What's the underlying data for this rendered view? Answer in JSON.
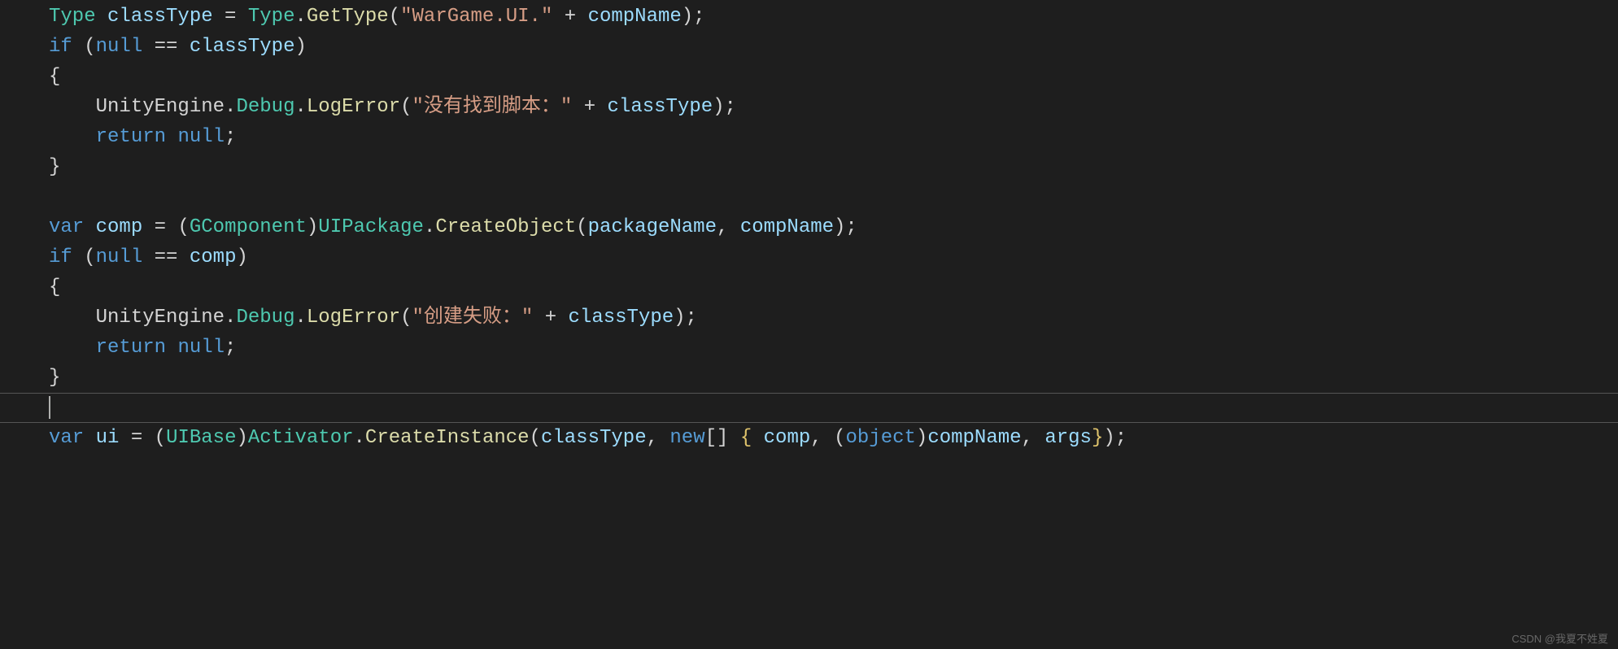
{
  "code": {
    "lines": [
      [
        {
          "cls": "tok-type",
          "txt": "Type"
        },
        {
          "cls": "tok-punct",
          "txt": " "
        },
        {
          "cls": "tok-var",
          "txt": "classType"
        },
        {
          "cls": "tok-punct",
          "txt": " "
        },
        {
          "cls": "tok-op",
          "txt": "="
        },
        {
          "cls": "tok-punct",
          "txt": " "
        },
        {
          "cls": "tok-type",
          "txt": "Type"
        },
        {
          "cls": "tok-punct",
          "txt": "."
        },
        {
          "cls": "tok-method",
          "txt": "GetType"
        },
        {
          "cls": "tok-punct",
          "txt": "("
        },
        {
          "cls": "tok-string",
          "txt": "\"WarGame.UI.\""
        },
        {
          "cls": "tok-punct",
          "txt": " "
        },
        {
          "cls": "tok-op",
          "txt": "+"
        },
        {
          "cls": "tok-punct",
          "txt": " "
        },
        {
          "cls": "tok-var",
          "txt": "compName"
        },
        {
          "cls": "tok-punct",
          "txt": ");"
        }
      ],
      [
        {
          "cls": "tok-keyword",
          "txt": "if"
        },
        {
          "cls": "tok-punct",
          "txt": " ("
        },
        {
          "cls": "tok-keyword",
          "txt": "null"
        },
        {
          "cls": "tok-punct",
          "txt": " "
        },
        {
          "cls": "tok-op",
          "txt": "=="
        },
        {
          "cls": "tok-punct",
          "txt": " "
        },
        {
          "cls": "tok-var",
          "txt": "classType"
        },
        {
          "cls": "tok-punct",
          "txt": ")"
        }
      ],
      [
        {
          "cls": "tok-punct",
          "txt": "{"
        }
      ],
      [
        {
          "cls": "tok-punct",
          "txt": "    "
        },
        {
          "cls": "tok-namespace",
          "txt": "UnityEngine"
        },
        {
          "cls": "tok-punct",
          "txt": "."
        },
        {
          "cls": "tok-type",
          "txt": "Debug"
        },
        {
          "cls": "tok-punct",
          "txt": "."
        },
        {
          "cls": "tok-method",
          "txt": "LogError"
        },
        {
          "cls": "tok-punct",
          "txt": "("
        },
        {
          "cls": "tok-string",
          "txt": "\"没有找到脚本：\""
        },
        {
          "cls": "tok-punct",
          "txt": " "
        },
        {
          "cls": "tok-op",
          "txt": "+"
        },
        {
          "cls": "tok-punct",
          "txt": " "
        },
        {
          "cls": "tok-var",
          "txt": "classType"
        },
        {
          "cls": "tok-punct",
          "txt": ");"
        }
      ],
      [
        {
          "cls": "tok-punct",
          "txt": "    "
        },
        {
          "cls": "tok-keyword",
          "txt": "return"
        },
        {
          "cls": "tok-punct",
          "txt": " "
        },
        {
          "cls": "tok-keyword",
          "txt": "null"
        },
        {
          "cls": "tok-punct",
          "txt": ";"
        }
      ],
      [
        {
          "cls": "tok-punct",
          "txt": "}"
        }
      ],
      [
        {
          "cls": "tok-punct",
          "txt": ""
        }
      ],
      [
        {
          "cls": "tok-keyword",
          "txt": "var"
        },
        {
          "cls": "tok-punct",
          "txt": " "
        },
        {
          "cls": "tok-var",
          "txt": "comp"
        },
        {
          "cls": "tok-punct",
          "txt": " "
        },
        {
          "cls": "tok-op",
          "txt": "="
        },
        {
          "cls": "tok-punct",
          "txt": " ("
        },
        {
          "cls": "tok-type",
          "txt": "GComponent"
        },
        {
          "cls": "tok-punct",
          "txt": ")"
        },
        {
          "cls": "tok-type",
          "txt": "UIPackage"
        },
        {
          "cls": "tok-punct",
          "txt": "."
        },
        {
          "cls": "tok-method",
          "txt": "CreateObject"
        },
        {
          "cls": "tok-punct",
          "txt": "("
        },
        {
          "cls": "tok-var",
          "txt": "packageName"
        },
        {
          "cls": "tok-punct",
          "txt": ", "
        },
        {
          "cls": "tok-var",
          "txt": "compName"
        },
        {
          "cls": "tok-punct",
          "txt": ");"
        }
      ],
      [
        {
          "cls": "tok-keyword",
          "txt": "if"
        },
        {
          "cls": "tok-punct",
          "txt": " ("
        },
        {
          "cls": "tok-keyword",
          "txt": "null"
        },
        {
          "cls": "tok-punct",
          "txt": " "
        },
        {
          "cls": "tok-op",
          "txt": "=="
        },
        {
          "cls": "tok-punct",
          "txt": " "
        },
        {
          "cls": "tok-var",
          "txt": "comp"
        },
        {
          "cls": "tok-punct",
          "txt": ")"
        }
      ],
      [
        {
          "cls": "tok-punct",
          "txt": "{"
        }
      ],
      [
        {
          "cls": "tok-punct",
          "txt": "    "
        },
        {
          "cls": "tok-namespace",
          "txt": "UnityEngine"
        },
        {
          "cls": "tok-punct",
          "txt": "."
        },
        {
          "cls": "tok-type",
          "txt": "Debug"
        },
        {
          "cls": "tok-punct",
          "txt": "."
        },
        {
          "cls": "tok-method",
          "txt": "LogError"
        },
        {
          "cls": "tok-punct",
          "txt": "("
        },
        {
          "cls": "tok-string",
          "txt": "\"创建失败：\""
        },
        {
          "cls": "tok-punct",
          "txt": " "
        },
        {
          "cls": "tok-op",
          "txt": "+"
        },
        {
          "cls": "tok-punct",
          "txt": " "
        },
        {
          "cls": "tok-var",
          "txt": "classType"
        },
        {
          "cls": "tok-punct",
          "txt": ");"
        }
      ],
      [
        {
          "cls": "tok-punct",
          "txt": "    "
        },
        {
          "cls": "tok-keyword",
          "txt": "return"
        },
        {
          "cls": "tok-punct",
          "txt": " "
        },
        {
          "cls": "tok-keyword",
          "txt": "null"
        },
        {
          "cls": "tok-punct",
          "txt": ";"
        }
      ],
      [
        {
          "cls": "tok-punct",
          "txt": "}"
        }
      ],
      [
        {
          "cls": "tok-punct",
          "txt": ""
        }
      ],
      [
        {
          "cls": "tok-keyword",
          "txt": "var"
        },
        {
          "cls": "tok-punct",
          "txt": " "
        },
        {
          "cls": "tok-var",
          "txt": "ui"
        },
        {
          "cls": "tok-punct",
          "txt": " "
        },
        {
          "cls": "tok-op",
          "txt": "="
        },
        {
          "cls": "tok-punct",
          "txt": " ("
        },
        {
          "cls": "tok-type",
          "txt": "UIBase"
        },
        {
          "cls": "tok-punct",
          "txt": ")"
        },
        {
          "cls": "tok-type",
          "txt": "Activator"
        },
        {
          "cls": "tok-punct",
          "txt": "."
        },
        {
          "cls": "tok-method",
          "txt": "CreateInstance"
        },
        {
          "cls": "tok-punct",
          "txt": "("
        },
        {
          "cls": "tok-var",
          "txt": "classType"
        },
        {
          "cls": "tok-punct",
          "txt": ", "
        },
        {
          "cls": "tok-keyword",
          "txt": "new"
        },
        {
          "cls": "tok-punct",
          "txt": "[] "
        },
        {
          "cls": "tok-brace",
          "txt": "{"
        },
        {
          "cls": "tok-punct",
          "txt": " "
        },
        {
          "cls": "tok-var",
          "txt": "comp"
        },
        {
          "cls": "tok-punct",
          "txt": ", ("
        },
        {
          "cls": "tok-keyword",
          "txt": "object"
        },
        {
          "cls": "tok-punct",
          "txt": ")"
        },
        {
          "cls": "tok-var",
          "txt": "compName"
        },
        {
          "cls": "tok-punct",
          "txt": ", "
        },
        {
          "cls": "tok-var",
          "txt": "args"
        },
        {
          "cls": "tok-brace",
          "txt": "}"
        },
        {
          "cls": "tok-punct",
          "txt": ");"
        }
      ]
    ]
  },
  "highlight_line_index": 13,
  "watermark": "CSDN @我夏不姓夏"
}
